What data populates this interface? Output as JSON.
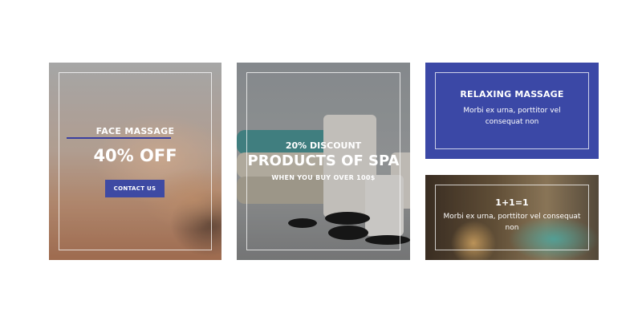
{
  "cards": {
    "face": {
      "title": "FACE MASSAGE",
      "offer": "40% OFF",
      "button_label": "CONTACT US"
    },
    "spa": {
      "pre_title": "20% DISCOUNT",
      "title": "PRODUCTS OF SPA",
      "subtitle": "WHEN YOU BUY OVER 100$"
    },
    "relax": {
      "title": "RELAXING MASSAGE",
      "description": "Morbi ex urna, porttitor vel consequat non"
    },
    "pool": {
      "title": "1+1=1",
      "description": "Morbi ex urna, porttitor vel consequat non"
    }
  },
  "colors": {
    "accent_blue": "#3b48a6",
    "button_blue": "#3e4aa3"
  }
}
